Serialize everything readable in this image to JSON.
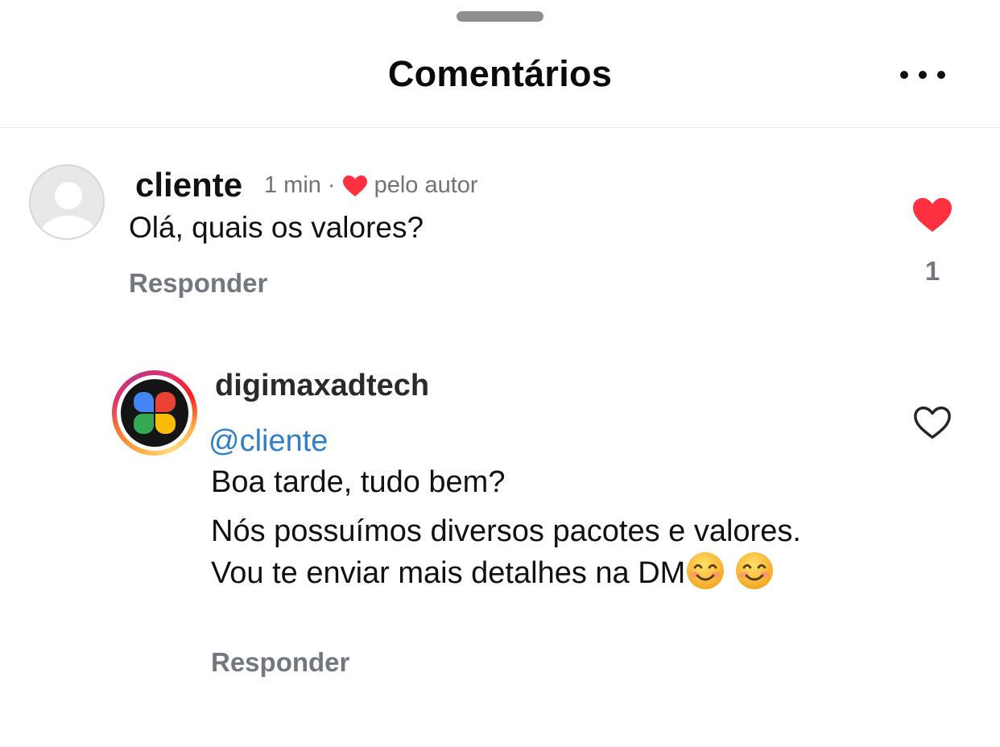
{
  "header": {
    "title": "Comentários",
    "more_icon": "more-horizontal-icon"
  },
  "comments": [
    {
      "username": "cliente",
      "time": "1 min",
      "separator": "·",
      "liked_by_author_label": "pelo autor",
      "text": "Olá, quais os valores?",
      "reply_label": "Responder",
      "liked": true,
      "like_count": "1",
      "avatar": "default-avatar-icon"
    },
    {
      "username": "digimaxadtech",
      "mention": "@cliente",
      "line1": "Boa tarde, tudo bem?",
      "line2": "Nós possuímos diversos pacotes e valores. Vou te enviar mais detalhes na DM",
      "emojis": [
        "smiling-face-emoji",
        "smiling-face-emoji"
      ],
      "reply_label": "Responder",
      "liked": false,
      "avatar": "digimaxadtech-logo",
      "has_story_ring": true
    }
  ],
  "colors": {
    "like_red": "#ff3040",
    "mention_blue": "#2f7fc9",
    "muted_text": "#737880",
    "grabber": "#8e8e93"
  }
}
